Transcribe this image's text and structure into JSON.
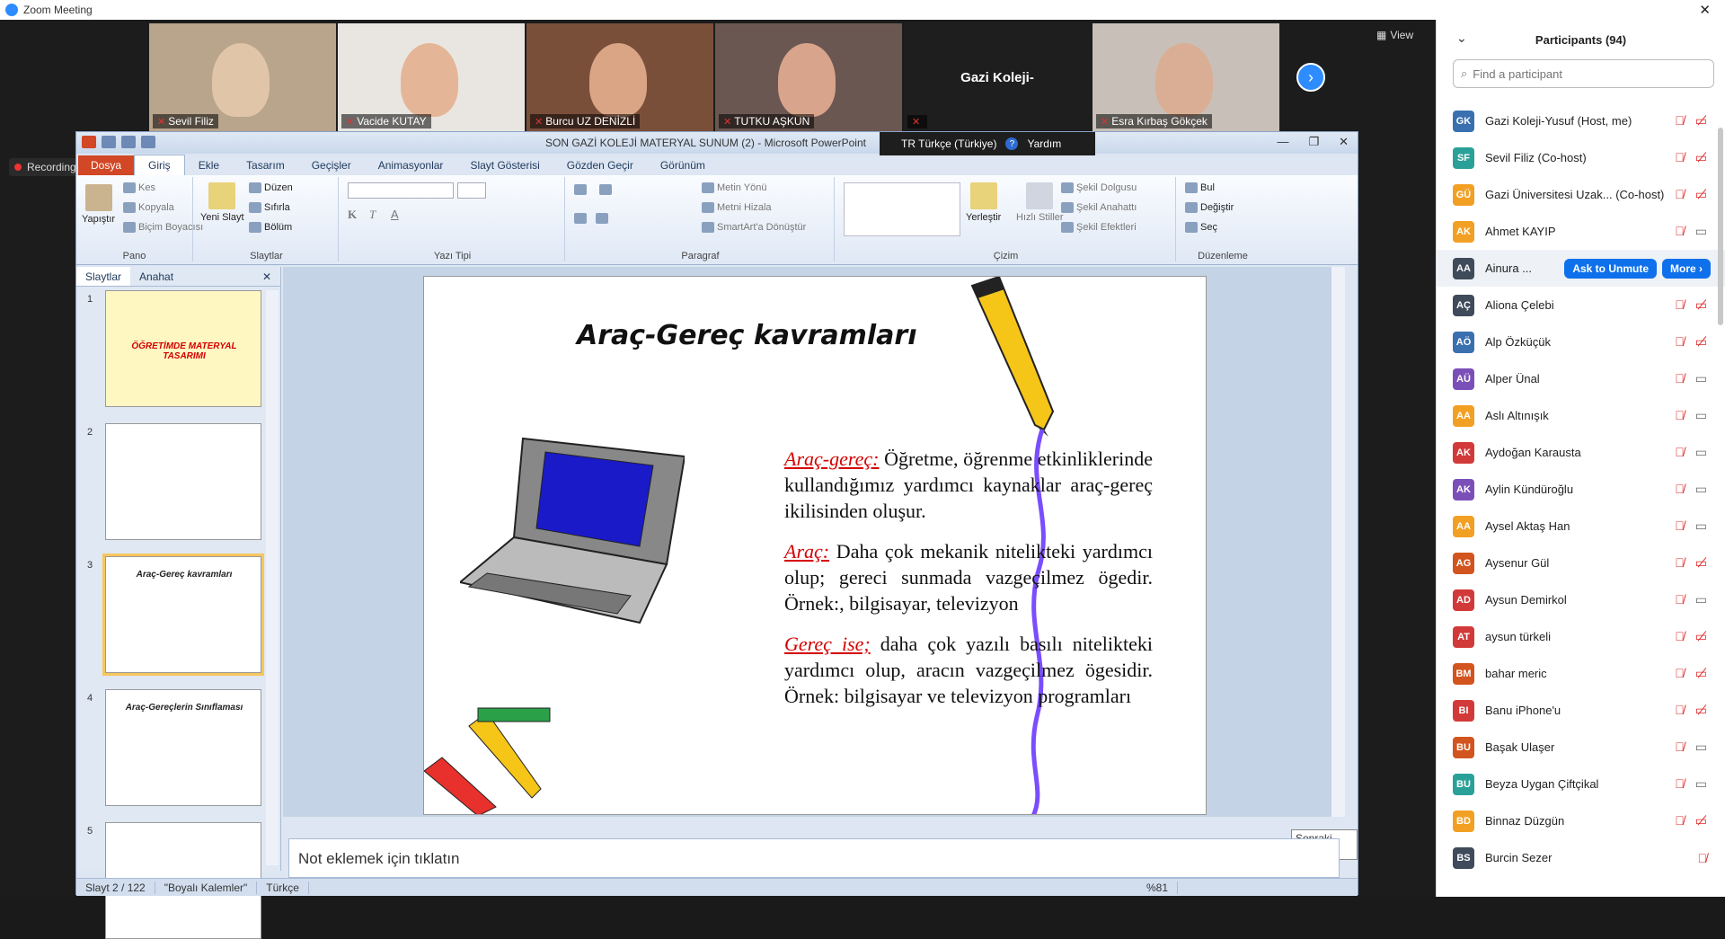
{
  "app": {
    "title": "Zoom Meeting",
    "close": "✕"
  },
  "video": {
    "tiles": [
      {
        "name": "Sevil Filiz",
        "bg": "#b9a48c",
        "face": "#e0c5a8"
      },
      {
        "name": "Vacide KUTAY",
        "bg": "#e9e6e2",
        "face": "#e4b697"
      },
      {
        "name": "Burcu UZ DENİZLİ",
        "bg": "#7a4f3a",
        "face": "#d9a584"
      },
      {
        "name": "TUTKU AŞKUN",
        "bg": "#6b5751",
        "face": "#d8a48b"
      },
      {
        "name": "",
        "bg": "#1e1e1e",
        "face": "",
        "big_label": "Gazi Koleji-"
      },
      {
        "name": "Esra Kırbaş Gökçek",
        "bg": "#c8c0b8",
        "face": "#d9ae94"
      }
    ],
    "view_label": "View",
    "recording_label": "Recording..."
  },
  "ppt": {
    "title": "SON GAZİ KOLEJİ MATERYAL SUNUM (2)  -  Microsoft PowerPoint",
    "lang": "TR Türkçe (Türkiye)",
    "help": "Yardım",
    "tabs": [
      "Dosya",
      "Giriş",
      "Ekle",
      "Tasarım",
      "Geçişler",
      "Animasyonlar",
      "Slayt Gösterisi",
      "Gözden Geçir",
      "Görünüm"
    ],
    "ribbon": {
      "pano": {
        "label": "Pano",
        "paste": "Yapıştır",
        "cut": "Kes",
        "copy": "Kopyala",
        "format": "Biçim Boyacısı"
      },
      "slaytlar": {
        "label": "Slaytlar",
        "new": "Yeni Slayt",
        "layout": "Düzen",
        "reset": "Sıfırla",
        "section": "Bölüm"
      },
      "yazi": {
        "label": "Yazı Tipi"
      },
      "paragraf": {
        "label": "Paragraf",
        "dir": "Metin Yönü",
        "align": "Metni Hizala",
        "smart": "SmartArt'a Dönüştür"
      },
      "cizim": {
        "label": "Çizim",
        "arrange": "Yerleştir",
        "quick": "Hızlı Stiller",
        "fill": "Şekil Dolgusu",
        "outline": "Şekil Anahattı",
        "effects": "Şekil Efektleri"
      },
      "duzen": {
        "label": "Düzenleme",
        "find": "Bul",
        "replace": "Değiştir",
        "select": "Seç"
      }
    },
    "pane_tabs": [
      "Slaytlar",
      "Anahat"
    ],
    "thumbs": [
      {
        "num": "1",
        "text": "ÖĞRETİMDE MATERYAL TASARIMI"
      },
      {
        "num": "2",
        "text": ""
      },
      {
        "num": "3",
        "text": "Araç-Gereç kavramları"
      },
      {
        "num": "4",
        "text": "Araç-Gereçlerin Sınıflaması"
      },
      {
        "num": "5",
        "text": ""
      }
    ],
    "slide": {
      "title": "Araç-Gereç kavramları",
      "p1_term": "Araç-gereç:",
      "p1": " Öğretme, öğrenme etkinliklerinde kullandığımız yardımcı kaynaklar araç-gereç ikilisinden oluşur.",
      "p2_term": "Araç:",
      "p2": " Daha çok mekanik nitelikteki yardımcı olup; gereci sunmada vazgeçilmez ögedir. Örnek:, bilgisayar, televizyon",
      "p3_term": "Gereç ise;",
      "p3": " daha çok yazılı basılı nitelikteki yardımcı olup, aracın vazgeçilmez ögesidir. Örnek: bilgisayar ve televizyon programları"
    },
    "tooltip": "Sonraki Slayt",
    "notes_placeholder": "Not eklemek için tıklatın",
    "status": {
      "slide": "Slayt 2 / 122",
      "theme": "\"Boyalı Kalemler\"",
      "lang": "Türkçe",
      "zoom": "%81"
    }
  },
  "participants": {
    "title": "Participants (94)",
    "search_placeholder": "Find a participant",
    "ask_unmute": "Ask to Unmute",
    "more": "More ›",
    "list": [
      {
        "initials": "GK",
        "name": "Gazi Koleji-Yusuf (Host, me)",
        "color": "#3a6fb0",
        "cam": "off"
      },
      {
        "initials": "SF",
        "name": "Sevil Filiz (Co-host)",
        "color": "#2aa198",
        "cam": "off"
      },
      {
        "initials": "GÜ",
        "name": "Gazi Üniversitesi Uzak...  (Co-host)",
        "color": "#f2a024",
        "cam": "off"
      },
      {
        "initials": "AK",
        "name": "Ahmet KAYIP",
        "color": "#f2a024",
        "cam": "on"
      },
      {
        "initials": "AA",
        "name": "Ainura ...",
        "color": "#3f4a5a",
        "cam": "",
        "hover": true
      },
      {
        "initials": "AÇ",
        "name": "Aliona Çelebi",
        "color": "#3f4a5a",
        "cam": "off"
      },
      {
        "initials": "AÖ",
        "name": "Alp Özküçük",
        "color": "#3a6fb0",
        "cam": "off"
      },
      {
        "initials": "AÜ",
        "name": "Alper Ünal",
        "color": "#7b4fb8",
        "cam": "on"
      },
      {
        "initials": "AA",
        "name": "Aslı Altınışık",
        "color": "#f2a024",
        "cam": "on"
      },
      {
        "initials": "AK",
        "name": "Aydoğan Karausta",
        "color": "#d23a3a",
        "cam": "on"
      },
      {
        "initials": "AK",
        "name": "Aylin Kündüroğlu",
        "color": "#7b4fb8",
        "cam": "on"
      },
      {
        "initials": "AA",
        "name": "Aysel Aktaş Han",
        "color": "#f2a024",
        "cam": "on"
      },
      {
        "initials": "AG",
        "name": "Aysenur Gül",
        "color": "#d2541e",
        "cam": "off"
      },
      {
        "initials": "AD",
        "name": "Aysun Demirkol",
        "color": "#d23a3a",
        "cam": "on"
      },
      {
        "initials": "AT",
        "name": "aysun türkeli",
        "color": "#d23a3a",
        "cam": "off"
      },
      {
        "initials": "BM",
        "name": "bahar meric",
        "color": "#d2541e",
        "cam": "off"
      },
      {
        "initials": "BI",
        "name": "Banu iPhone'u",
        "color": "#d23a3a",
        "cam": "off"
      },
      {
        "initials": "BU",
        "name": "Başak Ulaşer",
        "color": "#d2541e",
        "cam": "on"
      },
      {
        "initials": "BU",
        "name": "Beyza Uygan Çiftçikal",
        "color": "#2aa198",
        "cam": "on"
      },
      {
        "initials": "BD",
        "name": "Binnaz Düzgün",
        "color": "#f2a024",
        "cam": "off"
      },
      {
        "initials": "BS",
        "name": "Burcin Sezer",
        "color": "#3f4a5a",
        "cam": ""
      }
    ]
  }
}
